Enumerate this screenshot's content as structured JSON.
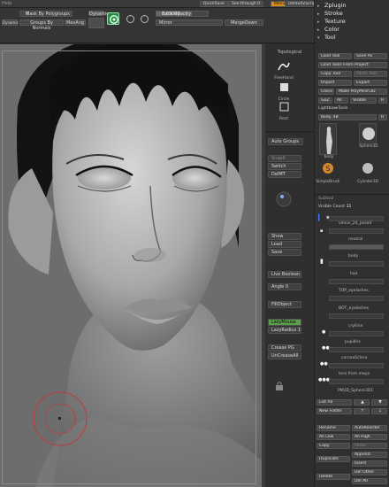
{
  "menubar": {
    "help": "Help",
    "quicksave": "QuickSave",
    "seethrough": "See-through",
    "seethrough_value": "0",
    "menus": "Menus",
    "script": "DefaultZScript"
  },
  "toolstrip": {
    "mask_by_polygroups": "Mask By Polygroups",
    "mask_by_polygroups_value": "0",
    "groups_by_normals": "Groups By Normals",
    "maxang": "MaxAng",
    "back_opacity": "Back Opacity",
    "back_opacity_value": "0.69047",
    "mirror": "Mirror",
    "mergedown": "MergeDown",
    "dynamic": "Dynamic",
    "dynamic_label": "Dynamic"
  },
  "shelf": {
    "topological": "Topological",
    "freehand": "FreeHand",
    "circle": "Circle",
    "rect": "Rect",
    "auto_groups": "Auto Groups",
    "snapit": "SnapIt",
    "switch": "Switch",
    "delmt": "DelMT",
    "show": "Show",
    "load": "Load",
    "save": "Save",
    "live_boolean": "Live Boolean",
    "angle": "Angle",
    "angle_value": "0",
    "fillobject": "FillObject",
    "lazymouse": "LazyMouse",
    "lazyradius": "LazyRadius",
    "lazyradius_value": "1",
    "crease_pg": "Crease PG",
    "uncreaseall": "UnCreaseAll"
  },
  "rpanel": {
    "menus": [
      {
        "label": "Zplugin"
      },
      {
        "label": "Stroke"
      },
      {
        "label": "Texture"
      },
      {
        "label": "Color"
      },
      {
        "label": "Tool"
      }
    ],
    "load_tool": "Load Tool",
    "save_as": "Save As",
    "load_tools_from_project": "Load Tools From Project",
    "copy_tool": "Copy Tool",
    "paste_tool": "Paste Tool",
    "import": "Import",
    "export": "Export",
    "clone": "Clone",
    "make_polymesh": "Make PolyMesh3D",
    "goz": "GoZ",
    "all": "All",
    "visible": "Visible",
    "r": "R",
    "lightbox_tools": "Lightbox▸Tools",
    "body": "body.",
    "body_value": "48",
    "r2": "R",
    "tools": [
      {
        "label": "body"
      },
      {
        "label": "Sphere3D"
      },
      {
        "label": "SimpleBrush"
      },
      {
        "label": "Cylinder3D"
      }
    ],
    "subtool": "Subtool",
    "visible_count": "Visible Count",
    "visible_count_value": "11",
    "subtools": [
      {
        "name": "venus_24_posed"
      },
      {
        "name": "neutral"
      },
      {
        "name": "body"
      },
      {
        "name": "hair"
      },
      {
        "name": "TOP_eyelashes"
      },
      {
        "name": "BOT_eyelashes"
      },
      {
        "name": "crylline"
      },
      {
        "name": "pupilIris"
      },
      {
        "name": "corneaSclera"
      },
      {
        "name": "lens from maya"
      },
      {
        "name": "PM3D_Sphere3D1"
      }
    ],
    "list_all": "List All",
    "new_folder": "New Folder",
    "rename": "Rename",
    "autoreorder": "AutoReorder",
    "all_low": "All Low",
    "all_high": "All High",
    "copy": "Copy",
    "paste": "Paste",
    "append": "Append",
    "duplicate": "Duplicate",
    "insert": "Insert",
    "del_other": "Del Other",
    "delete": "Delete",
    "del_all": "Del All"
  }
}
